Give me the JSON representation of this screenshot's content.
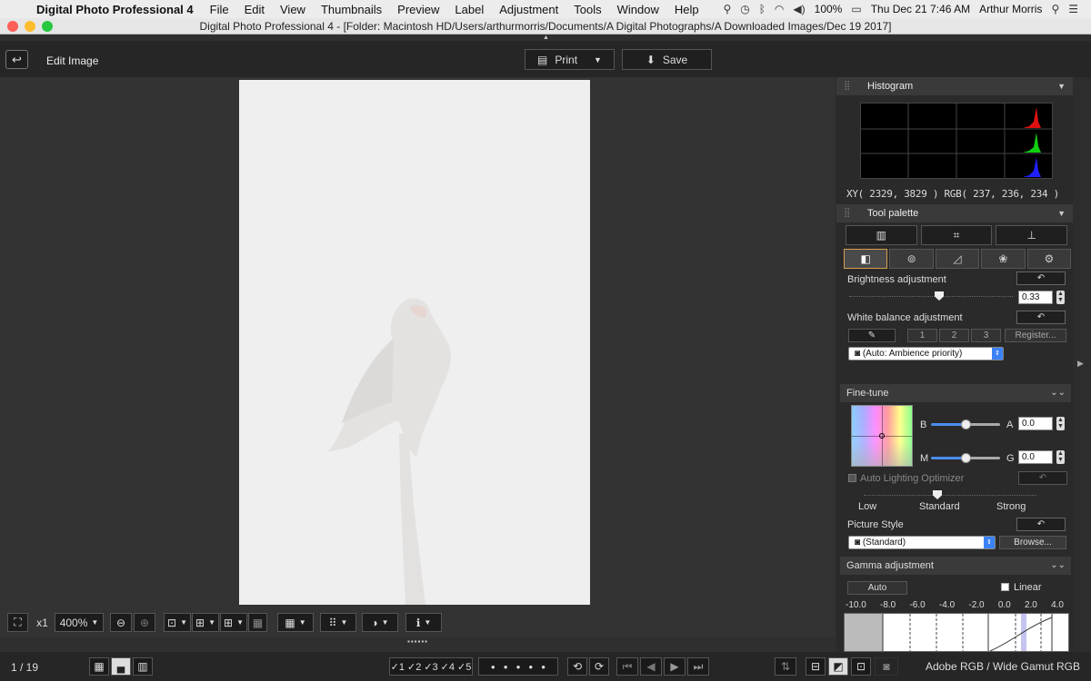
{
  "menubar": {
    "apple": "",
    "app_name": "Digital Photo Professional 4",
    "items": [
      "File",
      "Edit",
      "View",
      "Thumbnails",
      "Preview",
      "Label",
      "Adjustment",
      "Tools",
      "Window",
      "Help"
    ],
    "battery": "100%",
    "clock": "Thu Dec 21  7:46 AM",
    "user": "Arthur Morris"
  },
  "window": {
    "title": "Digital Photo Professional 4 - [Folder: Macintosh HD/Users/arthurmorris/Documents/A Digital Photographs/A Downloaded Images/Dec 19 2017]"
  },
  "toolbar": {
    "mode_label": "Edit Image",
    "print_label": "Print",
    "save_label": "Save"
  },
  "viewer_tools": {
    "zoom_ratio": "x1",
    "zoom_select": "400%"
  },
  "statusbar": {
    "page": "1 / 19",
    "color_space": "Adobe RGB / Wide Gamut RGB"
  },
  "histogram": {
    "title": "Histogram",
    "readout": "XY( 2329,  3829 ) RGB( 237, 236, 234 )"
  },
  "tool_palette": {
    "title": "Tool palette",
    "brightness_label": "Brightness adjustment",
    "brightness_value": "0.33",
    "brightness_level": 0.55,
    "wb_label": "White balance adjustment",
    "wb_buttons": [
      "1",
      "2",
      "3"
    ],
    "register_label": "Register...",
    "wb_select": "(Auto: Ambience priority)",
    "finetune_title": "Fine-tune",
    "b_label": "B",
    "a_label": "A",
    "ba_value": "0.0",
    "m_label": "M",
    "g_label": "G",
    "mg_value": "0.0",
    "alo_label": "Auto Lighting Optimizer",
    "alo_levels": [
      "Low",
      "Standard",
      "Strong"
    ],
    "picture_style_label": "Picture Style",
    "picture_style_select": "(Standard)",
    "browse_label": "Browse...",
    "gamma_title": "Gamma adjustment",
    "auto_label": "Auto",
    "linear_label": "Linear",
    "gamma_ticks": [
      "-10.0",
      "-8.0",
      "-6.0",
      "-4.0",
      "-2.0",
      "0.0",
      "2.0",
      "4.0"
    ]
  },
  "colors": {
    "accent_tab": "#d4a050",
    "select_arrow": "#3b82f6",
    "histo_red": "#e01010",
    "histo_green": "#10d010",
    "histo_blue": "#2020ff"
  }
}
